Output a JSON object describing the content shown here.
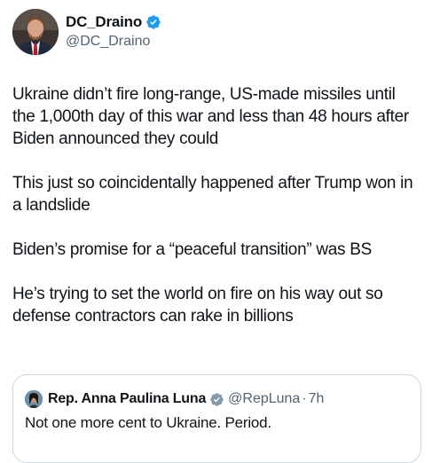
{
  "author": {
    "name": "DC_Draino",
    "handle": "@DC_Draino",
    "avatar_icon": "profile-photo",
    "verified_icon": "verified-badge-icon",
    "verified_color": "#1d9bf0"
  },
  "tweet": {
    "paragraphs": [
      "Ukraine didn’t fire long-range, US-made missiles until the 1,000th day of this war and less than 48 hours after Biden announced they could",
      "This just so coincidentally happened after Trump won in a landslide",
      "Biden’s promise for a “peaceful transition” was BS",
      "He’s trying to set the world on fire on his way out so defense contractors can rake in billions"
    ]
  },
  "quoted_tweet": {
    "name": "Rep. Anna Paulina Luna",
    "handle": "@RepLuna",
    "separator": "·",
    "time": "7h",
    "text": "Not one more cent to Ukraine. Period.",
    "verified_icon": "verified-badge-icon",
    "verified_color": "#829aab"
  }
}
